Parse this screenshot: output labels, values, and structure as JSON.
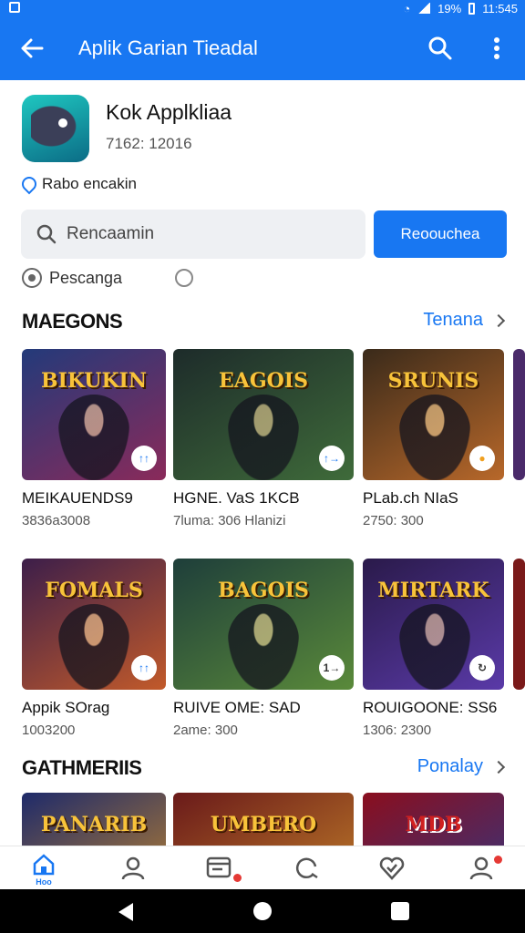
{
  "status_bar": {
    "battery": "19%",
    "time": "11:545"
  },
  "app_bar": {
    "title": "Aplik Garian Tieadal"
  },
  "app_info": {
    "name": "Kok Applkliaa",
    "meta": "7162: 12016",
    "developer": "Rabo encakin"
  },
  "search": {
    "placeholder": "Rencaamin",
    "button_label": "Reoouchea"
  },
  "filter": {
    "label": "Pescanga"
  },
  "section1": {
    "title": "MAEGONS",
    "link": "Tenana",
    "cards": [
      {
        "art_title": "BIKUKIN",
        "name": "MEIKAUENDS9",
        "sub": "3836a3008",
        "badge": "↑↑",
        "colors": [
          "#233a7a",
          "#8a2a5a"
        ]
      },
      {
        "art_title": "EAGOIS",
        "name": "HGNE. VaS       1KCB",
        "sub": "7luma: 306    Hlanizi",
        "badge": "↑→",
        "colors": [
          "#1d2b2a",
          "#3f6b3a"
        ]
      },
      {
        "art_title": "SRUNIS",
        "name": "PLab.ch NIaS",
        "sub": "2750: 300",
        "badge": "●",
        "colors": [
          "#3a2a1a",
          "#b8682a"
        ]
      }
    ]
  },
  "section1_row2": {
    "cards": [
      {
        "art_title": "FOMALS",
        "name": "Appik SOrag",
        "sub": "1003200",
        "badge": "↑↑",
        "colors": [
          "#3c1e4a",
          "#c25a2a"
        ]
      },
      {
        "art_title": "BAGOIS",
        "name": "RUIVE OME: SAD",
        "sub": "2ame: 300",
        "badge": "1→",
        "colors": [
          "#1e3e3a",
          "#5a8a3a"
        ]
      },
      {
        "art_title": "MIRTARK",
        "name": "ROUIGOONE: SS6",
        "sub": "1306: 2300",
        "badge": "↻",
        "colors": [
          "#2a1a4a",
          "#5a3aa8"
        ]
      }
    ]
  },
  "section2": {
    "title": "GATHMERIIS",
    "link": "Ponalay",
    "cards": [
      {
        "art_title": "PANARIB",
        "colors": [
          "#1e2a6a",
          "#c98a2a"
        ]
      },
      {
        "art_title": "UMBERO",
        "colors": [
          "#6a1a1a",
          "#c8862a"
        ]
      },
      {
        "art_title": "MDB",
        "colors": [
          "#8a0e1e",
          "#2a3a8a"
        ]
      }
    ]
  },
  "bottom_nav": {
    "home_label": "Hoo"
  }
}
